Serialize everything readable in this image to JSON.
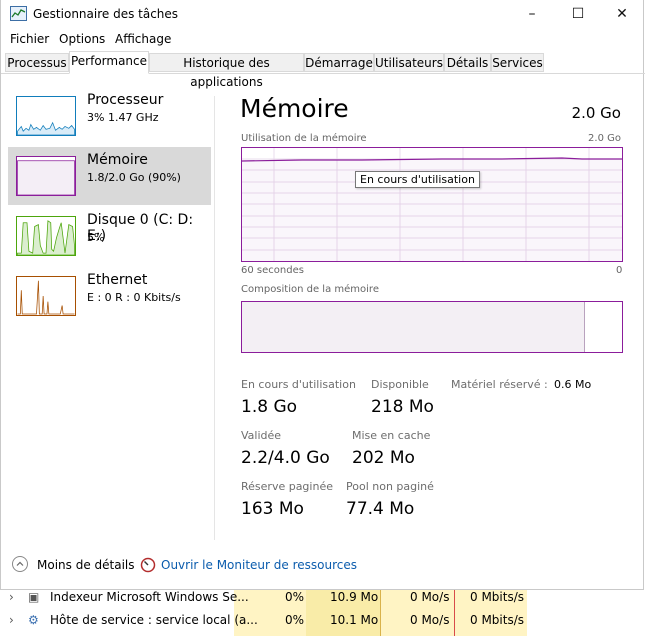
{
  "window": {
    "title": "Gestionnaire des tâches",
    "controls": [
      "–",
      "☐",
      "✕"
    ]
  },
  "menu": [
    "Fichier",
    "Options",
    "Affichage"
  ],
  "tabs": [
    "Processus",
    "Performance",
    "Historique des applications",
    "Démarrage",
    "Utilisateurs",
    "Détails",
    "Services"
  ],
  "sidebar": [
    {
      "title": "Processeur",
      "sub": "3%  1.47 GHz"
    },
    {
      "title": "Mémoire",
      "sub": "1.8/2.0 Go (90%)"
    },
    {
      "title": "Disque 0 (C: D: E:)",
      "sub": "5%"
    },
    {
      "title": "Ethernet",
      "sub": "E : 0  R : 0 Kbits/s"
    }
  ],
  "main": {
    "title": "Mémoire",
    "total": "2.0 Go",
    "usage_label": "Utilisation de la mémoire",
    "usage_max": "2.0 Go",
    "tooltip": "En cours d'utilisation",
    "time_label": "60 secondes",
    "time_end": "0",
    "composition_label": "Composition de la mémoire",
    "composition_in_use_fraction": 0.9,
    "stats": {
      "in_use_label": "En cours d'utilisation",
      "in_use": "1.8 Go",
      "available_label": "Disponible",
      "available": "218 Mo",
      "reserved_label": "Matériel réservé :",
      "reserved": "0.6 Mo",
      "committed_label": "Validée",
      "committed": "2.2/4.0 Go",
      "cached_label": "Mise en cache",
      "cached": "202 Mo",
      "paged_label": "Réserve paginée",
      "paged": "163 Mo",
      "nonpaged_label": "Pool non paginé",
      "nonpaged": "77.4 Mo"
    }
  },
  "footer": {
    "less_details": "Moins de détails",
    "open_monitor": "Ouvrir le Moniteur de ressources"
  },
  "background_rows": [
    {
      "name": "Indexeur Microsoft Windows Se...",
      "cpu": "0%",
      "mem": "10.9 Mo",
      "disk": "0 Mo/s",
      "net": "0 Mbits/s"
    },
    {
      "name": "Hôte de service : service local (a...",
      "cpu": "0%",
      "mem": "10.1 Mo",
      "disk": "0 Mo/s",
      "net": "0 Mbits/s"
    }
  ],
  "colors": {
    "memory": "#8b1d9b",
    "cpu": "#117dbb",
    "disk": "#4da60c",
    "ethernet": "#a74f01",
    "link": "#0b5cad",
    "heat": "#fff4c4"
  }
}
